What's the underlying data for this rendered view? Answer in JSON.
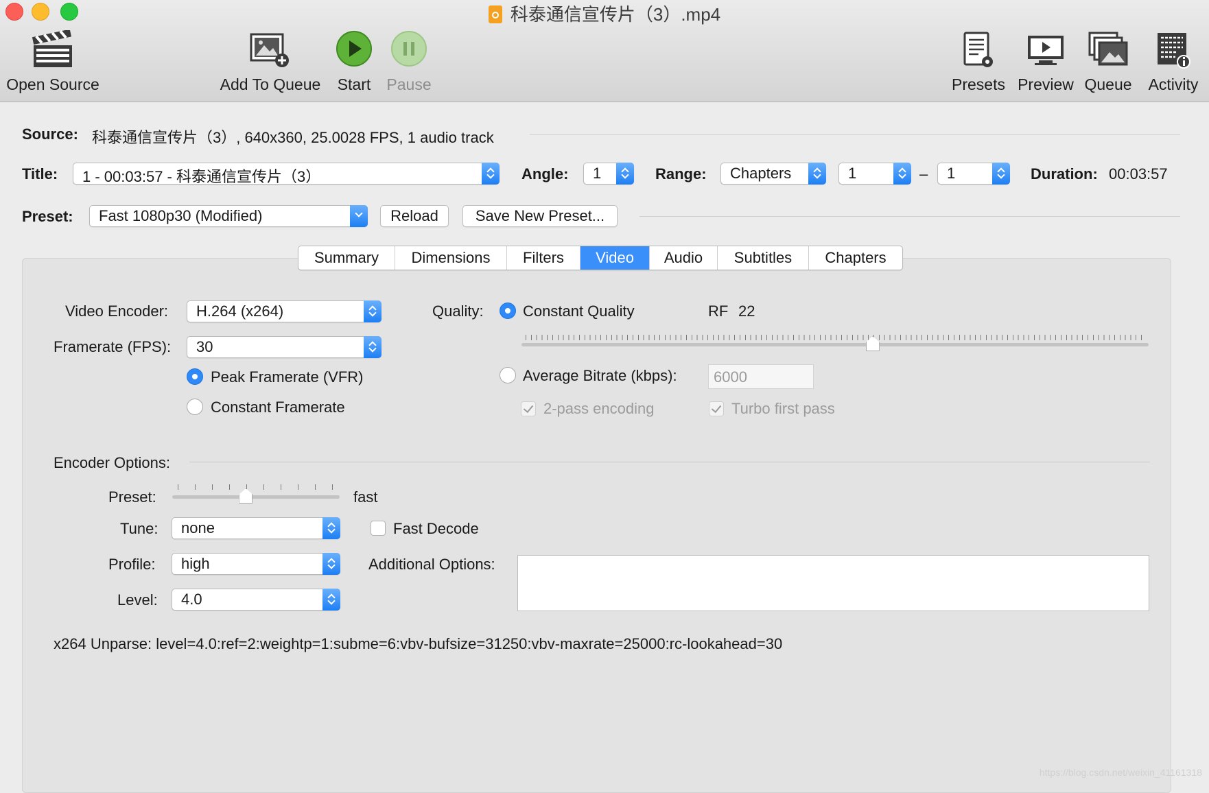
{
  "window": {
    "title": "科泰通信宣传片（3）.mp4"
  },
  "toolbar": {
    "open_source": "Open Source",
    "add_to_queue": "Add To Queue",
    "start": "Start",
    "pause": "Pause",
    "presets": "Presets",
    "preview": "Preview",
    "queue": "Queue",
    "activity": "Activity"
  },
  "source": {
    "label": "Source:",
    "value": "科泰通信宣传片（3）, 640x360, 25.0028 FPS, 1 audio track"
  },
  "title_row": {
    "title_label": "Title:",
    "title_value": "1 - 00:03:57 - 科泰通信宣传片（3）",
    "angle_label": "Angle:",
    "angle_value": "1",
    "range_label": "Range:",
    "range_type": "Chapters",
    "range_start": "1",
    "range_sep": "–",
    "range_end": "1",
    "duration_label": "Duration:",
    "duration_value": "00:03:57"
  },
  "preset_row": {
    "label": "Preset:",
    "value": "Fast 1080p30 (Modified)",
    "reload": "Reload",
    "save_new": "Save New Preset..."
  },
  "tabs": [
    "Summary",
    "Dimensions",
    "Filters",
    "Video",
    "Audio",
    "Subtitles",
    "Chapters"
  ],
  "active_tab": "Video",
  "video": {
    "encoder_label": "Video Encoder:",
    "encoder_value": "H.264 (x264)",
    "framerate_label": "Framerate (FPS):",
    "framerate_value": "30",
    "peak_framerate": "Peak Framerate (VFR)",
    "constant_framerate": "Constant Framerate",
    "quality_label": "Quality:",
    "constant_quality": "Constant Quality",
    "rf_label": "RF",
    "rf_value": "22",
    "rf_slider_fraction": 0.56,
    "average_bitrate": "Average Bitrate (kbps):",
    "bitrate_value": "6000",
    "two_pass": "2-pass encoding",
    "turbo_first_pass": "Turbo first pass"
  },
  "encoder_options": {
    "heading": "Encoder Options:",
    "preset_label": "Preset:",
    "preset_value": "fast",
    "preset_slider_fraction": 0.44,
    "tune_label": "Tune:",
    "tune_value": "none",
    "fast_decode": "Fast Decode",
    "profile_label": "Profile:",
    "profile_value": "high",
    "additional_options_label": "Additional Options:",
    "additional_options_value": "",
    "level_label": "Level:",
    "level_value": "4.0",
    "unparse": "x264 Unparse: level=4.0:ref=2:weightp=1:subme=6:vbv-bufsize=31250:vbv-maxrate=25000:rc-lookahead=30"
  },
  "watermark": "https://blog.csdn.net/weixin_41161318",
  "colors": {
    "accent": "#3a8ffb",
    "close": "#fc5f57",
    "minimize": "#fdbc2e",
    "zoom": "#28c840"
  }
}
